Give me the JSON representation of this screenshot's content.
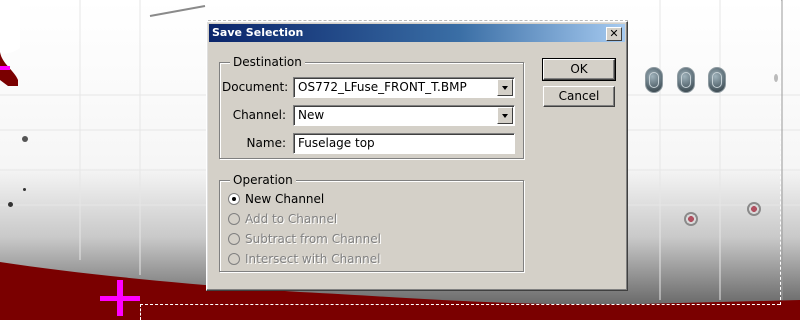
{
  "dialog": {
    "title": "Save Selection",
    "close_glyph": "✕",
    "destination": {
      "legend": "Destination",
      "document_label": "Document:",
      "document_value": "OS772_LFuse_FRONT_T.BMP",
      "channel_label": "Channel:",
      "channel_value": "New",
      "name_label": "Name:",
      "name_value": "Fuselage top"
    },
    "operation": {
      "legend": "Operation",
      "options": [
        {
          "label": "New Channel",
          "selected": true,
          "enabled": true
        },
        {
          "label": "Add to Channel",
          "selected": false,
          "enabled": false
        },
        {
          "label": "Subtract from Channel",
          "selected": false,
          "enabled": false
        },
        {
          "label": "Intersect with Channel",
          "selected": false,
          "enabled": false
        }
      ]
    },
    "buttons": {
      "ok": "OK",
      "cancel": "Cancel"
    }
  },
  "colors": {
    "title_bar_start": "#0a246a",
    "dialog_face": "#d4d0c8",
    "background_maroon": "#7a0000",
    "marker_magenta": "#ff00ff"
  }
}
